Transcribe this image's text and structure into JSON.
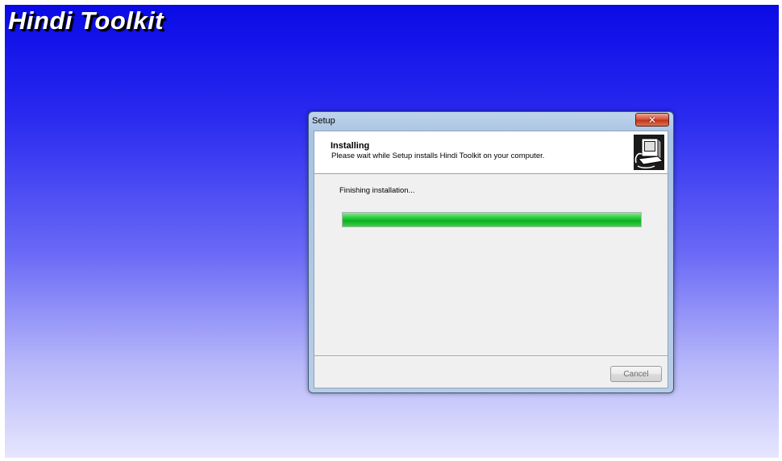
{
  "app": {
    "title": "Hindi Toolkit"
  },
  "window": {
    "title": "Setup",
    "close_icon": "close-icon"
  },
  "header": {
    "title": "Installing",
    "subtitle": "Please wait while Setup installs Hindi Toolkit on your computer.",
    "logo_icon": "computer-setup-icon"
  },
  "progress": {
    "status_text": "Finishing installation...",
    "value": 1.0,
    "color": "#1fc02e"
  },
  "footer": {
    "cancel_label": "Cancel"
  },
  "colors": {
    "background_top": "#0a0ae6",
    "background_bottom": "#e6e6fe",
    "title_text": "#ffffff"
  }
}
